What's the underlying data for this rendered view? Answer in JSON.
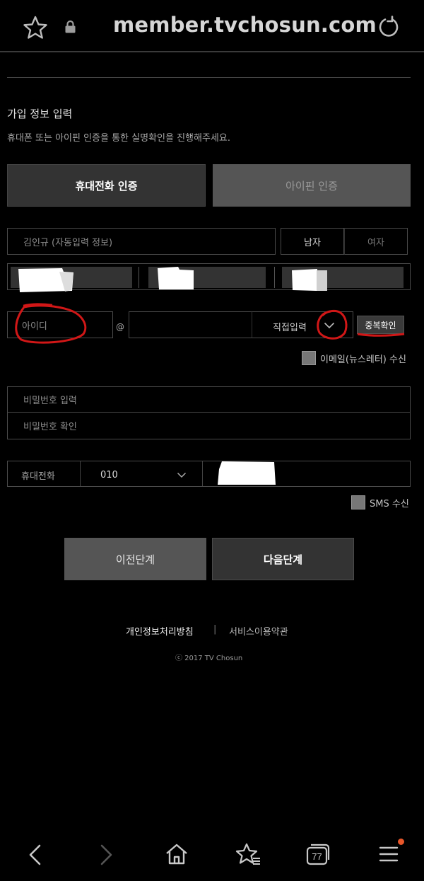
{
  "browser": {
    "url": "member.tvchosun.com",
    "badge_color": "#e8572a"
  },
  "form": {
    "title": "가입 정보 입력",
    "subtitle": "휴대폰 또는 아이핀 인증을 통한 실명확인을 진행해주세요.",
    "tabs": {
      "phone": "휴대전화 인증",
      "ipin": "아이핀 인증"
    },
    "name_value": "김인규 (자동입력 정보)",
    "gender": {
      "male": "남자",
      "female": "여자",
      "selected": "남자"
    },
    "id_placeholder": "아이디",
    "at_symbol": "@",
    "domain_select": "직접입력",
    "dup_check": "중복확인",
    "email_newsletter": "이메일(뉴스레터) 수신",
    "password_placeholder": "비밀번호 입력",
    "password_confirm_placeholder": "비밀번호 확인",
    "phone_label": "휴대전화",
    "phone_prefix": "010",
    "sms": "SMS 수신",
    "prev_button": "이전단계",
    "next_button": "다음단계"
  },
  "footer": {
    "privacy": "개인정보처리방침",
    "separator": "|",
    "terms": "서비스이용약관",
    "copyright": "ⓒ 2017 TV Chosun"
  },
  "navbar": {
    "tabs_count": "77"
  }
}
